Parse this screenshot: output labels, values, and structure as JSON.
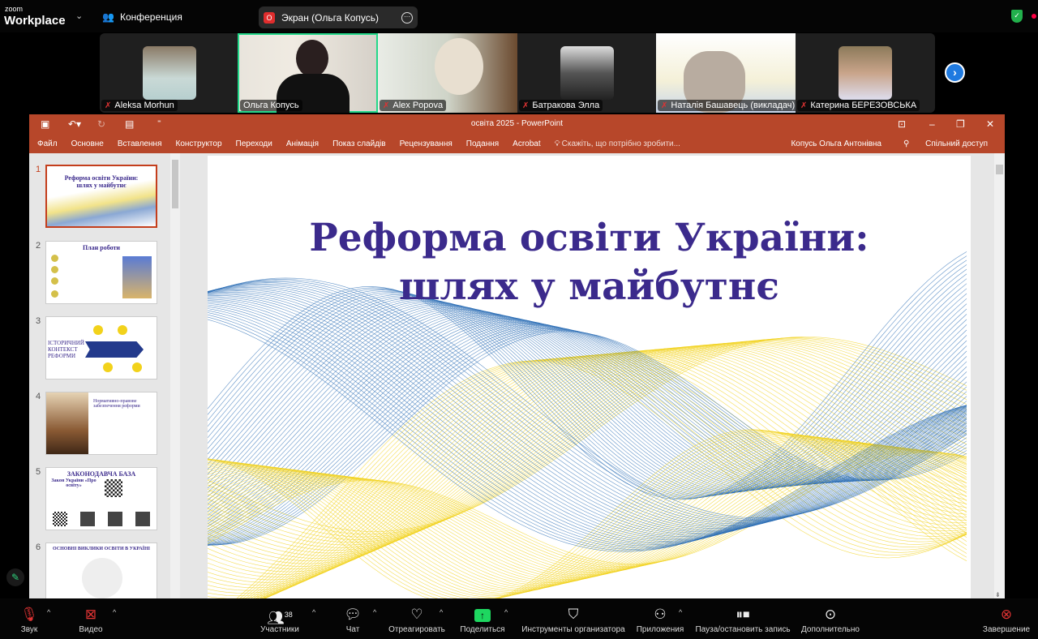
{
  "topbar": {
    "logo_small": "zoom",
    "logo_big": "Workplace",
    "conference_label": "Конференция",
    "screen_share_label": "Экран (Ольга Копусь)",
    "rec_letter": "O"
  },
  "gallery": {
    "participants": [
      {
        "name": "Aleksa Morhun",
        "muted": true
      },
      {
        "name": "Ольга Копусь",
        "muted": false,
        "active": true
      },
      {
        "name": "Alex Popova",
        "muted": true
      },
      {
        "name": "Батракова Элла",
        "muted": true
      },
      {
        "name": "Наталія Башавець (викладач)",
        "muted": true
      },
      {
        "name": "Катерина БЕРЕЗОВСЬКА",
        "muted": true
      }
    ]
  },
  "ppt": {
    "window_title": "освіта 2025 - PowerPoint",
    "tabs": [
      "Файл",
      "Основне",
      "Вставлення",
      "Конструктор",
      "Переходи",
      "Анімація",
      "Показ слайдів",
      "Рецензування",
      "Подання",
      "Acrobat"
    ],
    "tell_me": "Скажіть, що потрібно зробити...",
    "user": "Копусь Ольга Антонівна",
    "share": "Спільний доступ",
    "thumbnails": [
      {
        "num": "1",
        "title": "Реформа освіти України: шлях у майбутнє"
      },
      {
        "num": "2",
        "title": "План роботи"
      },
      {
        "num": "3",
        "title": "ІСТОРИЧНИЙ КОНТЕКСТ РЕФОРМИ"
      },
      {
        "num": "4",
        "title": "Нормативно-правове забезпечення реформи"
      },
      {
        "num": "5",
        "title": "ЗАКОНОДАВЧА БАЗА",
        "subtitle": "Закон України «Про освіту»"
      },
      {
        "num": "6",
        "title": "ОСНОВНІ ВИКЛИКИ ОСВІТИ В УКРАЇНІ"
      }
    ],
    "slide": {
      "title_line1": "Реформа освіти України:",
      "title_line2": "шлях у майбутнє"
    }
  },
  "toolbar": {
    "audio": "Звук",
    "video": "Видео",
    "participants": "Участники",
    "participants_count": "38",
    "chat": "Чат",
    "react": "Отреагировать",
    "share": "Поделиться",
    "host_tools": "Инструменты организатора",
    "apps": "Приложения",
    "record": "Пауза/остановить запись",
    "more": "Дополнительно",
    "end": "Завершение"
  },
  "colors": {
    "ppt_accent": "#b7472a",
    "slide_title": "#3b2a8c",
    "wave_blue": "#2e6fb5",
    "wave_yellow": "#f2d21b",
    "share_green": "#1ed760"
  }
}
